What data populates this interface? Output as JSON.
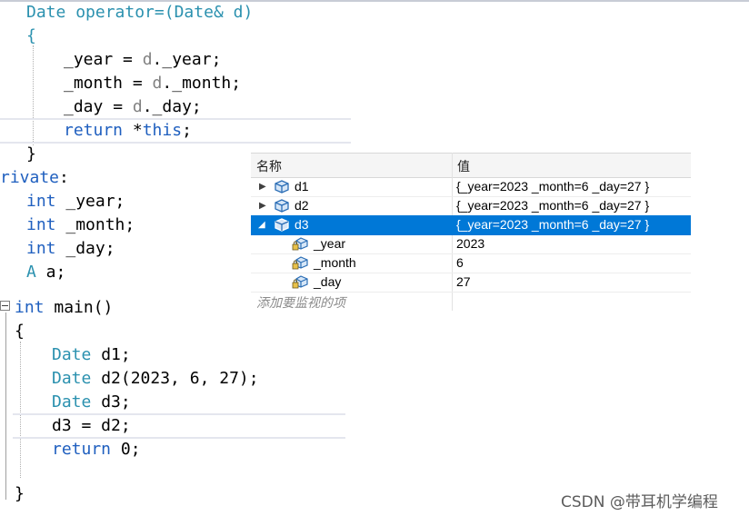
{
  "code": {
    "l1": {
      "type": "Date",
      "op": " operator=(",
      "type2": "Date",
      "amp": "& ",
      "param": "d",
      "close": ")"
    },
    "l2": "{",
    "l3": {
      "lhs": "_year",
      "eq": " = ",
      "param": "d",
      "rest": "._year;"
    },
    "l4": {
      "lhs": "_month",
      "eq": " = ",
      "param": "d",
      "rest": "._month;"
    },
    "l5": {
      "lhs": "_day",
      "eq": " = ",
      "param": "d",
      "rest": "._day;"
    },
    "l6": {
      "kw": "return",
      "star": " *",
      "kw2": "this",
      "semi": ";"
    },
    "l7": "}",
    "l8": {
      "text": "rivate",
      "colon": ":"
    },
    "l9": {
      "kw": "int",
      "rest": " _year;"
    },
    "l10": {
      "kw": "int",
      "rest": " _month;"
    },
    "l11": {
      "kw": "int",
      "rest": " _day;"
    },
    "l12": {
      "type": "A",
      "rest": " a;"
    },
    "l13": {
      "kw": "int",
      "rest": " main()"
    },
    "l14": "{",
    "l15": {
      "type": "Date",
      "rest": " d1;"
    },
    "l16": {
      "type": "Date",
      "rest": " d2(2023, 6, 27);"
    },
    "l17": {
      "type": "Date",
      "rest": " d3;"
    },
    "l18": "d3 = d2;",
    "l19": {
      "kw": "return",
      "rest": " 0;"
    },
    "l20": "}"
  },
  "watch": {
    "col_name": "名称",
    "col_value": "值",
    "rows": [
      {
        "name": "d1",
        "value": "{_year=2023 _month=6 _day=27 }",
        "expander": "▶"
      },
      {
        "name": "d2",
        "value": "{_year=2023 _month=6 _day=27 }",
        "expander": "▶"
      },
      {
        "name": "d3",
        "value": "{_year=2023 _month=6 _day=27 }",
        "expander": "◢"
      },
      {
        "name": "_year",
        "value": "2023"
      },
      {
        "name": "_month",
        "value": "6"
      },
      {
        "name": "_day",
        "value": "27"
      }
    ],
    "add_hint": "添加要监视的项"
  },
  "watermark": "CSDN @带耳机学编程",
  "colors": {
    "keyword": "#1f5fbf",
    "type": "#2b91af",
    "selection": "#0078d7"
  }
}
